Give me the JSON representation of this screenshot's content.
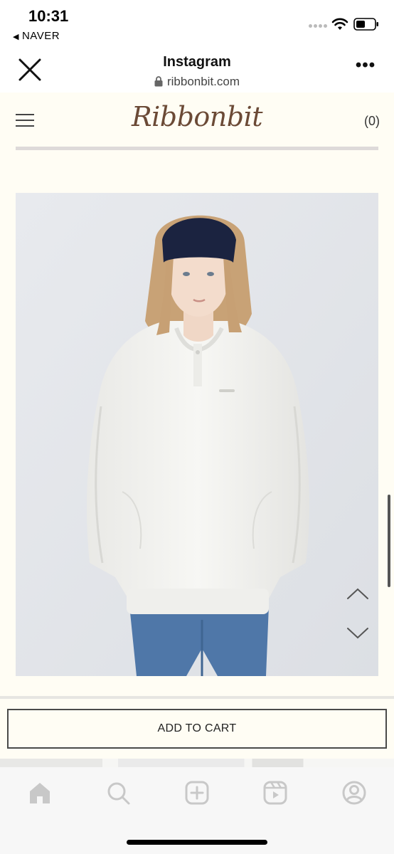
{
  "status_bar": {
    "time": "10:31",
    "back_app": "NAVER",
    "back_icon": "back-triangle-icon"
  },
  "browser": {
    "title": "Instagram",
    "url": "ribbonbit.com",
    "close_icon": "close-icon",
    "more_icon": "more-dots-icon",
    "more_label": "•••"
  },
  "site": {
    "logo": "Ribbonbit",
    "cart_count": "(0)",
    "menu_icon": "hamburger-menu-icon"
  },
  "product": {
    "image_alt": "Model wearing white oversized henley sweatshirt with navy headband and blue jeans",
    "prev_icon": "chevron-up-icon",
    "next_icon": "chevron-down-icon"
  },
  "actions": {
    "add_to_cart": "ADD TO CART"
  },
  "bottom_nav": {
    "items": [
      "home-icon",
      "search-icon",
      "create-icon",
      "reels-icon",
      "profile-icon"
    ]
  },
  "colors": {
    "page_bg": "#fffdf4",
    "logo": "#6b4a36",
    "image_bg": "#e4e7eb"
  }
}
